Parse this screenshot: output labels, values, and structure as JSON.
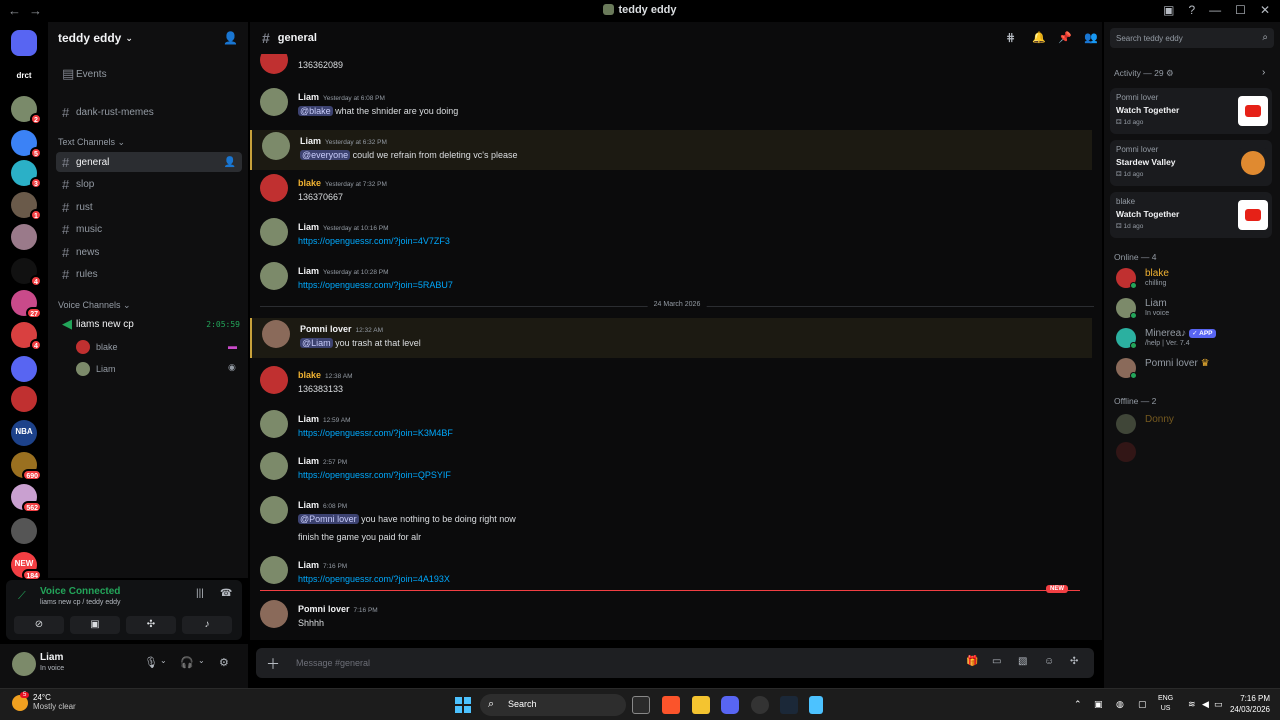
{
  "window": {
    "title": "teddy eddy",
    "back": "←",
    "forward": "→"
  },
  "guilds": [
    {
      "label": "2",
      "color": "#5865f2",
      "badge": "2"
    },
    {
      "label": "drct",
      "color": "#000000",
      "badge": ""
    },
    {
      "label": "",
      "color": "#7a8a6a",
      "badge": "2"
    },
    {
      "label": "",
      "color": "#3b82f6",
      "badge": "5"
    },
    {
      "label": "",
      "color": "#2bb0c7",
      "badge": "3"
    },
    {
      "label": "",
      "color": "#6a5a4a",
      "badge": "1"
    },
    {
      "label": "",
      "color": "#9a7a8a",
      "badge": ""
    },
    {
      "label": "",
      "color": "#111111",
      "badge": "4"
    },
    {
      "label": "",
      "color": "#c94a8a",
      "badge": "27"
    },
    {
      "label": "",
      "color": "#d94040",
      "badge": "4"
    },
    {
      "label": "",
      "color": "#5865f2",
      "badge": ""
    },
    {
      "label": "",
      "color": "#c03030",
      "badge": ""
    },
    {
      "label": "NBA",
      "color": "#1d428a",
      "badge": ""
    },
    {
      "label": "",
      "color": "#9a7020",
      "badge": "690"
    },
    {
      "label": "",
      "color": "#c9a0d0",
      "badge": "562"
    },
    {
      "label": "",
      "color": "#555555",
      "badge": ""
    },
    {
      "label": "NEW",
      "color": "#f23f43",
      "badge": "184"
    }
  ],
  "server": {
    "name": "teddy eddy",
    "events": "Events",
    "text_category": "Text Channels",
    "voice_category": "Voice Channels",
    "pinned_channel": "dank-rust-memes",
    "channels": [
      "general",
      "slop",
      "rust",
      "music",
      "news",
      "rules"
    ],
    "voice_channel": {
      "name": "liams new cp",
      "time": "2:05:59",
      "users": [
        "blake",
        "Liam"
      ]
    }
  },
  "voice_panel": {
    "title": "Voice Connected",
    "sub": "liams new cp / teddy eddy"
  },
  "user": {
    "name": "Liam",
    "status": "In voice"
  },
  "channel_header": {
    "name": "general"
  },
  "messages": [
    {
      "author": "",
      "time": "",
      "text": "136362089",
      "color": "#f2f3f5"
    },
    {
      "author": "Liam",
      "time": "Yesterday at 6:08 PM",
      "mention": "@blake",
      "text": " what the shnider are you doing",
      "color": "#f2f3f5"
    },
    {
      "author": "Liam",
      "time": "Yesterday at 6:32 PM",
      "mention": "@everyone",
      "text": " could we refrain from deleting vc's please",
      "color": "#f2f3f5"
    },
    {
      "author": "blake",
      "time": "Yesterday at 7:32 PM",
      "text": "136370667",
      "color": "#f0b232"
    },
    {
      "author": "Liam",
      "time": "Yesterday at 10:16 PM",
      "link": "https://openguessr.com/?join=4V7ZF3",
      "color": "#f2f3f5"
    },
    {
      "author": "Liam",
      "time": "Yesterday at 10:28 PM",
      "link": "https://openguessr.com/?join=5RABU7",
      "color": "#f2f3f5"
    },
    {
      "author": "Pomni lover",
      "time": "12:32 AM",
      "mention": "@Liam",
      "text": " you trash at that level",
      "color": "#f2f3f5"
    },
    {
      "author": "blake",
      "time": "12:38 AM",
      "text": "136383133",
      "color": "#f0b232"
    },
    {
      "author": "Liam",
      "time": "12:59 AM",
      "link": "https://openguessr.com/?join=K3M4BF",
      "color": "#f2f3f5"
    },
    {
      "author": "Liam",
      "time": "2:57 PM",
      "link": "https://openguessr.com/?join=QPSYIF",
      "color": "#f2f3f5"
    },
    {
      "author": "Liam",
      "time": "6:08 PM",
      "mention": "@Pomni lover",
      "text": " you have nothing to be doing right now",
      "text2": "finish the game you paid for alr",
      "color": "#f2f3f5"
    },
    {
      "author": "Liam",
      "time": "7:16 PM",
      "link": "https://openguessr.com/?join=4A193X",
      "color": "#f2f3f5"
    },
    {
      "author": "Pomni lover",
      "time": "7:16 PM",
      "text": "Shhhh",
      "color": "#f2f3f5"
    }
  ],
  "date_divider": "24 March 2026",
  "new_tag": "NEW",
  "composer": {
    "placeholder": "Message #general"
  },
  "right": {
    "search_placeholder": "Search teddy eddy",
    "activity_label": "Activity — 29",
    "activities": [
      {
        "who": "Pomni lover",
        "game": "Watch Together",
        "ago": "1d ago"
      },
      {
        "who": "Pomni lover",
        "game": "Stardew Valley",
        "ago": "1d ago"
      },
      {
        "who": "blake",
        "game": "Watch Together",
        "ago": "1d ago"
      }
    ],
    "online_label": "Online — 4",
    "online": [
      {
        "name": "blake",
        "status": "chilling",
        "color": "#f0b232"
      },
      {
        "name": "Liam",
        "status": "In voice",
        "color": "#949ba4"
      },
      {
        "name": "Minerea♪",
        "status": "/help | Ver. 7.4",
        "color": "#949ba4",
        "tag": "APP"
      },
      {
        "name": "Pomni lover",
        "status": "",
        "color": "#949ba4"
      }
    ],
    "offline_label": "Offline — 2",
    "offline": [
      {
        "name": "Donny",
        "color": "#f0b232"
      }
    ]
  },
  "taskbar": {
    "temp": "24°C",
    "weather": "Mostly clear",
    "weather_badge": "5",
    "search": "Search",
    "lang1": "ENG",
    "lang2": "US",
    "time": "7:16 PM",
    "date": "24/03/2026"
  }
}
